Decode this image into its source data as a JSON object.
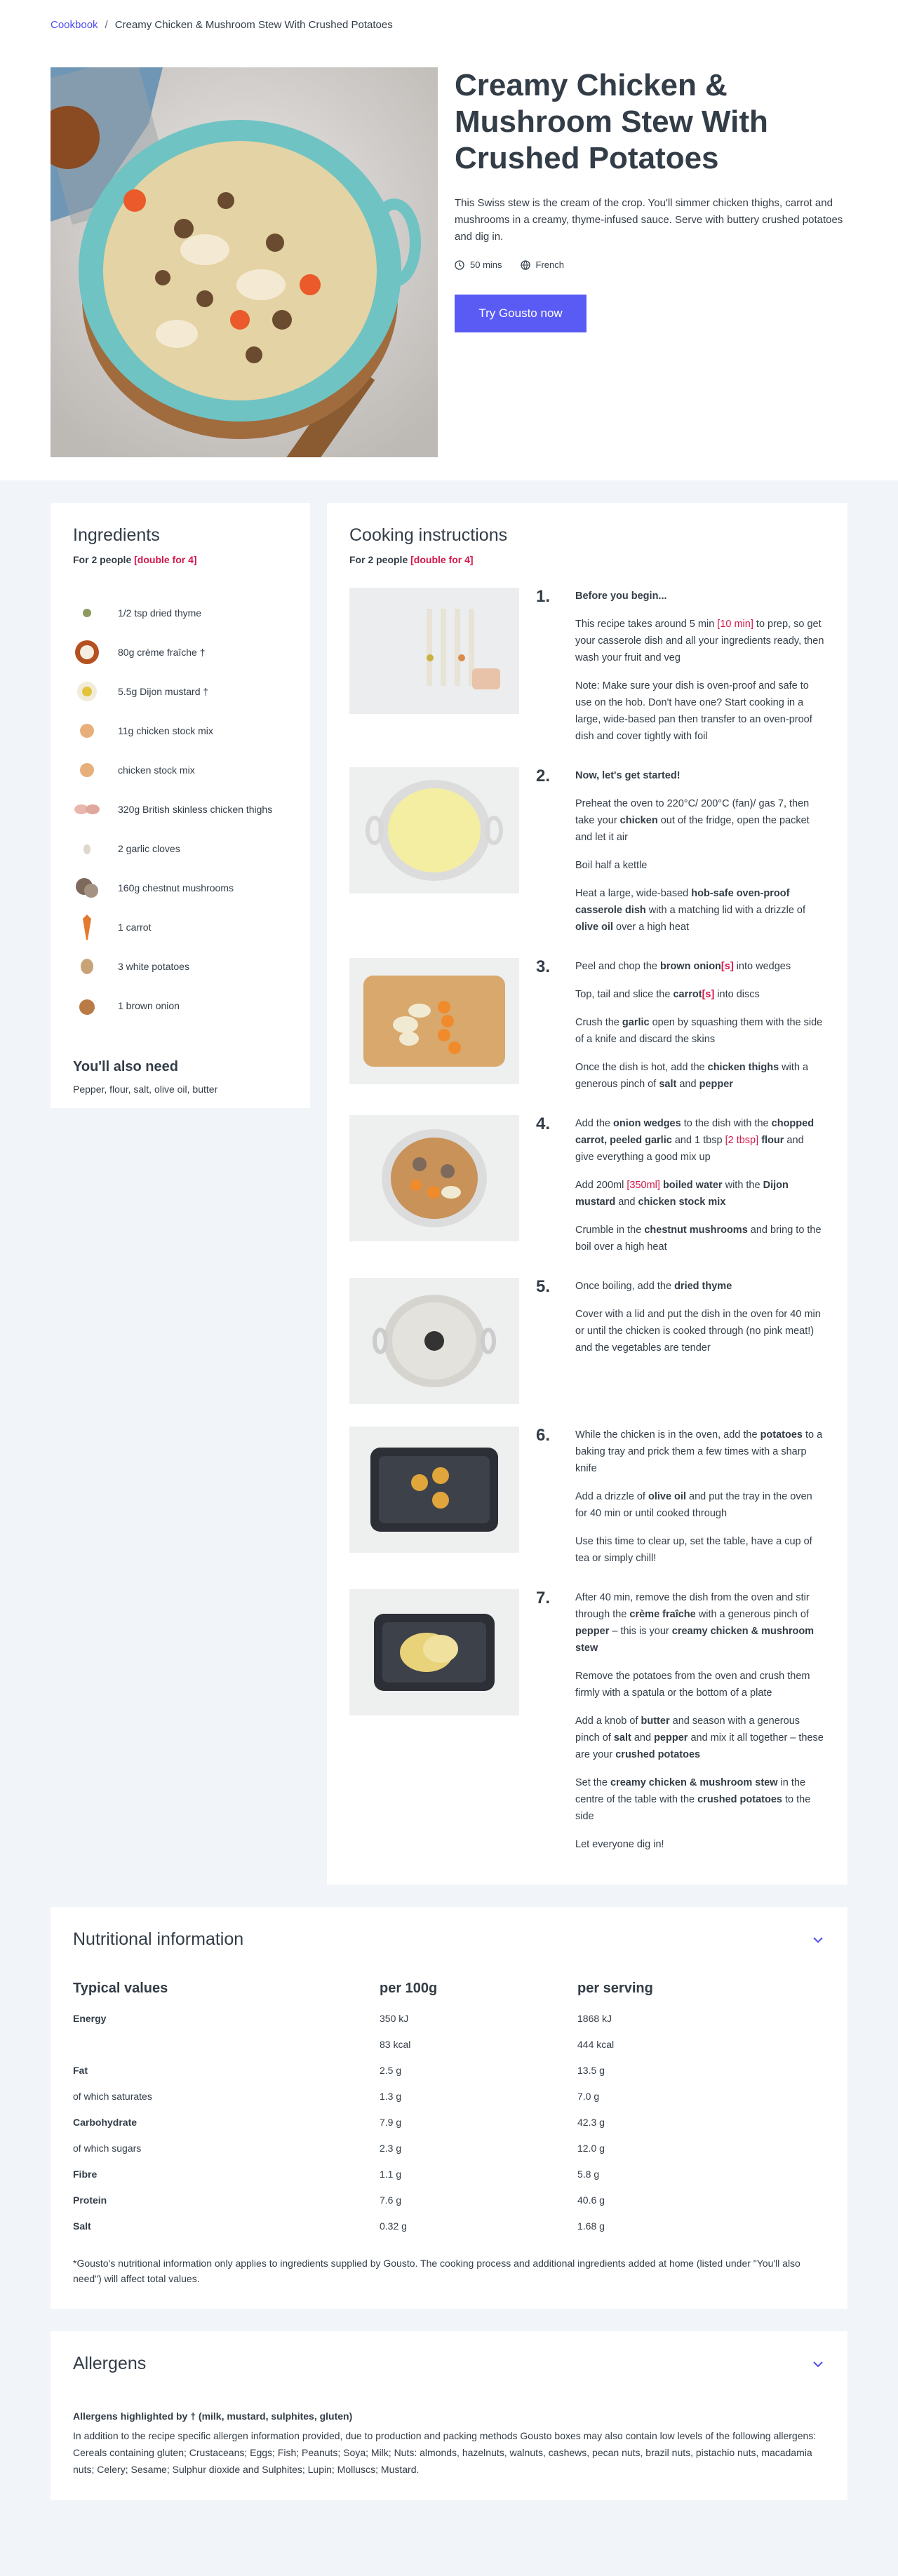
{
  "breadcrumb": {
    "root": "Cookbook",
    "separator": "/",
    "current": "Creamy Chicken & Mushroom Stew With Crushed Potatoes"
  },
  "hero": {
    "title": "Creamy Chicken & Mushroom Stew With Crushed Potatoes",
    "description": "This Swiss stew is the cream of the crop. You'll simmer chicken thighs, carrot and mushrooms in a creamy, thyme-infused sauce. Serve with buttery crushed potatoes and dig in.",
    "time": "50 mins",
    "cuisine": "French",
    "cta": "Try Gousto now"
  },
  "ingredients": {
    "title": "Ingredients",
    "people_prefix": "For 2 people",
    "double": "[double for 4]",
    "items": [
      "1/2 tsp dried thyme",
      "80g crème fraîche †",
      "5.5g Dijon mustard †",
      "11g chicken stock mix",
      "chicken stock mix",
      "320g British skinless chicken thighs",
      "2 garlic cloves",
      "160g chestnut mushrooms",
      "1 carrot",
      "3 white potatoes",
      "1 brown onion"
    ],
    "also_title": "You'll also need",
    "also_list": "Pepper, flour, salt, olive oil, butter"
  },
  "instructions": {
    "title": "Cooking instructions",
    "people_prefix": "For 2 people",
    "double": "[double for 4]",
    "steps": [
      {
        "num": "1."
      },
      {
        "num": "2."
      },
      {
        "num": "3."
      },
      {
        "num": "4."
      },
      {
        "num": "5."
      },
      {
        "num": "6."
      },
      {
        "num": "7."
      }
    ]
  },
  "nutrition": {
    "title": "Nutritional information",
    "headers": [
      "Typical values",
      "per 100g",
      "per serving"
    ],
    "rows": [
      {
        "label": "Energy",
        "group": true,
        "per100": "350 kJ",
        "serving": "1868 kJ"
      },
      {
        "label": "",
        "group": false,
        "per100": "83 kcal",
        "serving": "444 kcal"
      },
      {
        "label": "Fat",
        "group": true,
        "per100": "2.5 g",
        "serving": "13.5 g"
      },
      {
        "label": "of which saturates",
        "group": false,
        "per100": "1.3 g",
        "serving": "7.0 g"
      },
      {
        "label": "Carbohydrate",
        "group": true,
        "per100": "7.9 g",
        "serving": "42.3 g"
      },
      {
        "label": "of which sugars",
        "group": false,
        "per100": "2.3 g",
        "serving": "12.0 g"
      },
      {
        "label": "Fibre",
        "group": true,
        "per100": "1.1 g",
        "serving": "5.8 g"
      },
      {
        "label": "Protein",
        "group": true,
        "per100": "7.6 g",
        "serving": "40.6 g"
      },
      {
        "label": "Salt",
        "group": true,
        "per100": "0.32 g",
        "serving": "1.68 g"
      }
    ],
    "note": "*Gousto's nutritional information only applies to ingredients supplied by Gousto. The cooking process and additional ingredients added at home (listed under \"You'll also need\") will affect total values."
  },
  "allergens": {
    "title": "Allergens",
    "subtitle": "Allergens highlighted by † (milk, mustard, sulphites, gluten)",
    "text": "In addition to the recipe specific allergen information provided, due to production and packing methods Gousto boxes may also contain low levels of the following allergens: Cereals containing gluten; Crustaceans; Eggs; Fish; Peanuts; Soya; Milk; Nuts: almonds, hazelnuts, walnuts, cashews, pecan nuts, brazil nuts, pistachio nuts, macadamia nuts; Celery; Sesame; Sulphur dioxide and Sulphites; Lupin; Molluscs; Mustard."
  },
  "colors": {
    "accent": "#5a5af5",
    "highlight": "#d2174c",
    "text": "#333d47",
    "background": "#f1f4f8"
  }
}
